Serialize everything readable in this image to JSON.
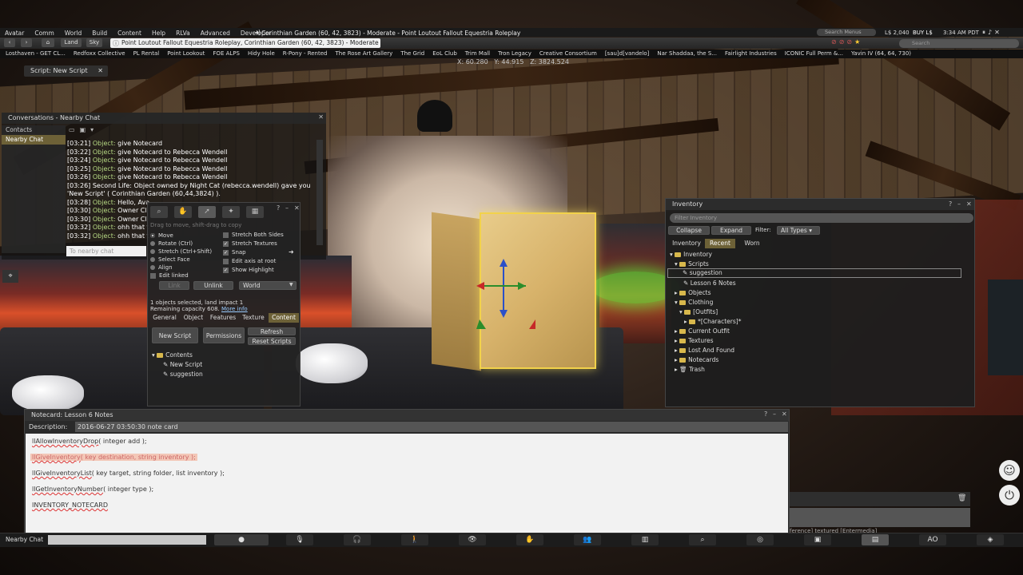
{
  "menubar": {
    "items": [
      "Avatar",
      "Comm",
      "World",
      "Build",
      "Content",
      "Help",
      "RLVa",
      "Advanced",
      "Developer"
    ],
    "title": "Corinthian Garden (60, 42, 3823) - Moderate - Point Loutout Fallout Equestria Roleplay",
    "search_placeholder": "Search Menus",
    "balance": "L$ 2,040",
    "buy_label": "BUY L$",
    "clock": "3:34 AM PDT"
  },
  "navbar": {
    "land_label": "Land",
    "sky_label": "Sky",
    "location": "Point Loutout Fallout Equestria Roleplay, Corinthian Garden (60, 42, 3823) - Moderate",
    "search_placeholder": "Search"
  },
  "favorites": [
    "Losthaven - GET CL...",
    "Redfoxx Collective",
    "PL Rental",
    "Point Lookout",
    "FOE ALPS",
    "Hidy Hole",
    "R-Pony - Rented",
    "The Rose Art Gallery",
    "The Grid",
    "EoL Club",
    "Trim Mall",
    "Tron Legacy",
    "Creative Consortium",
    "[sau]d[vandelo]",
    "Nar Shaddaa, the S...",
    "Fairlight Industries",
    "ICONIC Full Perm &...",
    "Yavin IV (64, 64, 730)"
  ],
  "coords": {
    "x": "X: 60.280",
    "y": "Y: 44.915",
    "z": "Z: 3824.524"
  },
  "script_tab": "Script: New Script",
  "conversations": {
    "title": "Conversations - Nearby Chat",
    "sidebar": [
      "Contacts",
      "Nearby Chat"
    ],
    "lines": [
      {
        "time": "[03:21]",
        "obj": "Object:",
        "text": "give Notecard"
      },
      {
        "time": "[03:22]",
        "obj": "Object:",
        "text": "give Notecard to Rebecca Wendell"
      },
      {
        "time": "[03:24]",
        "obj": "Object:",
        "text": "give Notecard to Rebecca Wendell"
      },
      {
        "time": "[03:25]",
        "obj": "Object:",
        "text": "give Notecard to Rebecca Wendell"
      },
      {
        "time": "[03:26]",
        "obj": "Object:",
        "text": "give Notecard to Rebecca Wendell"
      },
      {
        "time": "[03:26]",
        "obj": "",
        "text": "Second Life: Object owned by Night Cat (rebecca.wendell) gave you"
      },
      {
        "time": "",
        "obj": "",
        "text": "'New Script'  ( Corinthian Garden (60,44,3824) )."
      },
      {
        "time": "[03:28]",
        "obj": "Object:",
        "text": "Hello, Ava"
      },
      {
        "time": "[03:30]",
        "obj": "Object:",
        "text": "Owner Cl"
      },
      {
        "time": "[03:30]",
        "obj": "Object:",
        "text": "Owner Cl"
      },
      {
        "time": "[03:32]",
        "obj": "Object:",
        "text": "ohh that t"
      },
      {
        "time": "[03:32]",
        "obj": "Object:",
        "text": "ohh that t"
      }
    ],
    "input_placeholder": "To nearby chat"
  },
  "build": {
    "hint": "Drag to move, shift-drag to copy",
    "radios": [
      "Move",
      "Rotate (Ctrl)",
      "Stretch (Ctrl+Shift)",
      "Select Face",
      "Align",
      "Edit linked"
    ],
    "checks": [
      "Stretch Both Sides",
      "Stretch Textures",
      "Snap",
      "Edit axis at root",
      "Show Highlight"
    ],
    "link_label": "Link",
    "unlink_label": "Unlink",
    "world_label": "World",
    "selected": "1 objects selected, land impact 1",
    "remaining": "Remaining capacity 608.",
    "more_info": "More info",
    "tabs": [
      "General",
      "Object",
      "Features",
      "Texture",
      "Content"
    ],
    "new_script": "New Script",
    "permissions": "Permissions",
    "refresh": "Refresh",
    "reset_scripts": "Reset Scripts",
    "contents": [
      "Contents",
      "New Script",
      "suggestion"
    ]
  },
  "inventory": {
    "title": "Inventory",
    "filter_placeholder": "Filter Inventory",
    "collapse": "Collapse",
    "expand": "Expand",
    "filter_label": "Filter:",
    "all_types": "All Types",
    "tabs": [
      "Inventory",
      "Recent",
      "Worn"
    ],
    "tree": [
      "Inventory",
      "Scripts",
      "suggestion",
      "Lesson 6 Notes",
      "Objects",
      "Clothing",
      "[Outfits]",
      "*[Characters]*",
      "Current Outfit",
      "Textures",
      "Lost And Found",
      "Notecards",
      "Trash"
    ]
  },
  "notecard": {
    "title": "Notecard: Lesson 6 Notes",
    "desc_label": "Description:",
    "desc_value": "2016-06-27 03:50:30 note card",
    "lines": [
      {
        "fn": "llAllowInventoryDrop",
        "rest": "( integer add );"
      },
      {
        "fn": "llGiveInventory",
        "rest": "( key destination, string inventory );"
      },
      {
        "fn": "llGiveInventoryList",
        "rest": "( key target, string folder, list inventory );"
      },
      {
        "fn": "llGetInventoryNumber",
        "rest": "( integer type );"
      },
      {
        "fn": "INVENTORY_NOTECARD",
        "rest": ""
      }
    ]
  },
  "bottom": {
    "chat_label": "Nearby Chat",
    "ao_label": "AO",
    "bottom_text": "ference] textured [Entermedia]"
  }
}
